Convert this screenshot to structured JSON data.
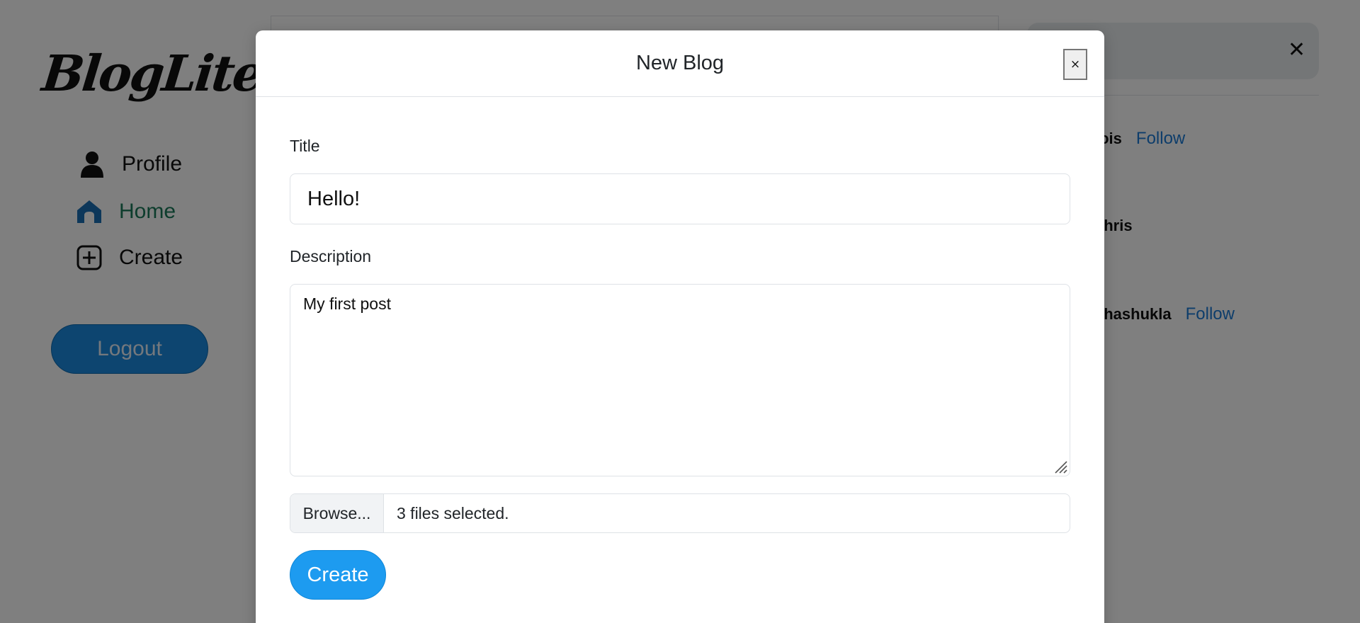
{
  "app": {
    "logo_text": "BlogLite"
  },
  "sidebar": {
    "items": [
      {
        "label": "Profile",
        "icon": "person-icon"
      },
      {
        "label": "Home",
        "icon": "home-icon",
        "active": true
      },
      {
        "label": "Create",
        "icon": "plus-square-icon"
      }
    ],
    "logout_label": "Logout"
  },
  "suggestions": [
    {
      "username": "lois",
      "action": "Follow"
    },
    {
      "username": "chris",
      "action": ""
    },
    {
      "username": "shashukla",
      "action": "Follow"
    }
  ],
  "modal": {
    "title": "New Blog",
    "close_label": "×",
    "title_label": "Title",
    "title_value": "Hello!",
    "description_label": "Description",
    "description_value": "My first post",
    "browse_label": "Browse...",
    "file_status": "3 files selected.",
    "submit_label": "Create"
  },
  "colors": {
    "accent": "#1d9bf0",
    "logout": "#1b8be0",
    "link": "#1b7ad6",
    "active_nav": "#1a7a5a",
    "backdrop": "rgba(0,0,0,0.5)"
  }
}
